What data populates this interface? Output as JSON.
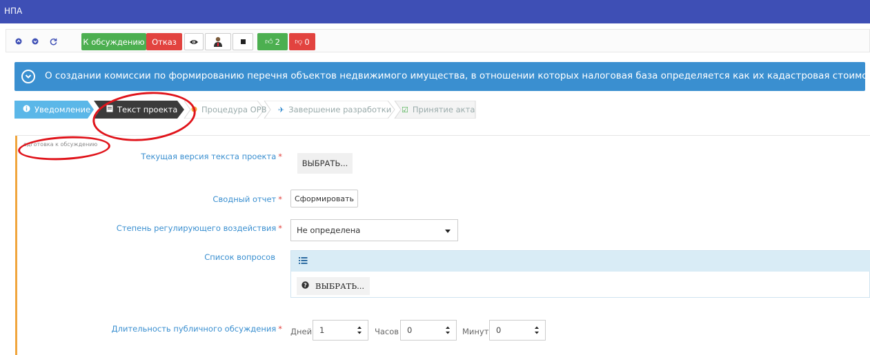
{
  "app": {
    "title": "НПА"
  },
  "toolbar": {
    "discuss_label": "К обсуждению",
    "reject_label": "Отказ",
    "likes": "2",
    "dislikes": "0",
    "colors": {
      "green": "#4caf50",
      "red": "#e2433f",
      "icon_blue": "#3e4fb5"
    }
  },
  "banner": {
    "text": "О создании комиссии по формированию перечня объектов недвижимого имущества, в отношении которых налоговая база определяется как их кадастровая стоимость"
  },
  "steps": [
    {
      "label": "Уведомление",
      "icon": "info-circle-icon",
      "state": "done"
    },
    {
      "label": "Текст проекта",
      "icon": "document-icon",
      "state": "active"
    },
    {
      "label": "Процедура ОРВ",
      "icon": "dot-icon",
      "state": "pending"
    },
    {
      "label": "Завершение разработки",
      "icon": "pin-icon",
      "state": "pending"
    },
    {
      "label": "Принятие акта",
      "icon": "check-square-icon",
      "state": "pending"
    }
  ],
  "form": {
    "caption": "одготовка к обсуждению",
    "current_version_label": "Текущая версия текста проекта",
    "current_version_button": "ВЫБРАТЬ...",
    "summary_label": "Сводный отчет",
    "summary_button": "Сформировать",
    "degree_label": "Степень регулирующего воздействия",
    "degree_value": "Не определена",
    "questions_label": "Список вопросов",
    "questions_button": "ВЫБРАТЬ...",
    "duration_label": "Длительность публичного обсуждения",
    "days_label": "Дней",
    "days_value": "1",
    "hours_label": "Часов",
    "hours_value": "0",
    "minutes_label": "Минут",
    "minutes_value": "0",
    "required_mark": "*"
  }
}
